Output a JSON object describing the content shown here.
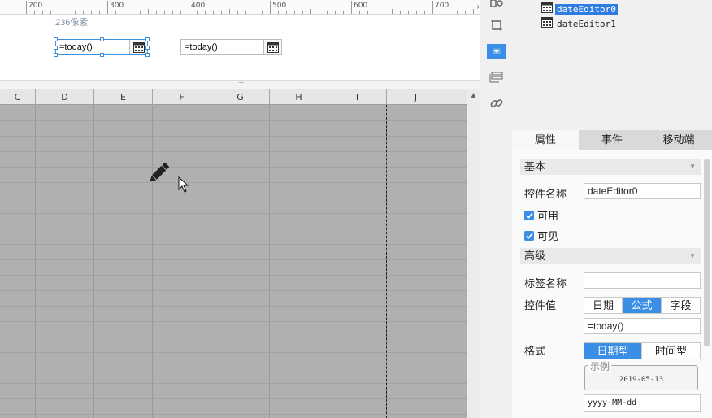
{
  "ruler": {
    "labels": [
      "200",
      "300",
      "400",
      "500",
      "600",
      "700"
    ],
    "end_marker": "›"
  },
  "canvas": {
    "size_label": "236像素",
    "divider_dots": "···",
    "widgets": [
      {
        "value": "=today()"
      },
      {
        "value": "=today()"
      }
    ]
  },
  "sheet": {
    "columns": [
      "C",
      "D",
      "E",
      "F",
      "G",
      "H",
      "I",
      "J"
    ],
    "scroll_up": "▲"
  },
  "tree": {
    "items": [
      {
        "label": "dateEditor0",
        "selected": true
      },
      {
        "label": "dateEditor1",
        "selected": false
      }
    ]
  },
  "tabs": [
    {
      "label": "属性",
      "active": true
    },
    {
      "label": "事件",
      "active": false
    },
    {
      "label": "移动端",
      "active": false
    }
  ],
  "props": {
    "basic": {
      "title": "基本",
      "name_label": "控件名称",
      "name_value": "dateEditor0",
      "enabled_label": "可用",
      "visible_label": "可见"
    },
    "advanced": {
      "title": "高级",
      "tag_label": "标签名称",
      "tag_value": "",
      "value_label": "控件值",
      "value_options": [
        "日期",
        "公式",
        "字段"
      ],
      "value_selected": "公式",
      "formula_value": "=today()",
      "format_label": "格式",
      "format_options": [
        "日期型",
        "时间型"
      ],
      "format_selected": "日期型",
      "example_legend": "示例",
      "example_value": "2019-05-13",
      "pattern_value": "yyyy-MM-dd"
    }
  },
  "colors": {
    "accent": "#3a8ee6",
    "sheet_bg": "#b0b0b0",
    "selected_tree": "#2f7de1"
  },
  "icons": [
    "calendar-icon",
    "pencil-icon",
    "mouse-cursor-icon",
    "frame-icon",
    "select-icon",
    "layers-icon",
    "link-icon",
    "chevron-down-icon"
  ]
}
